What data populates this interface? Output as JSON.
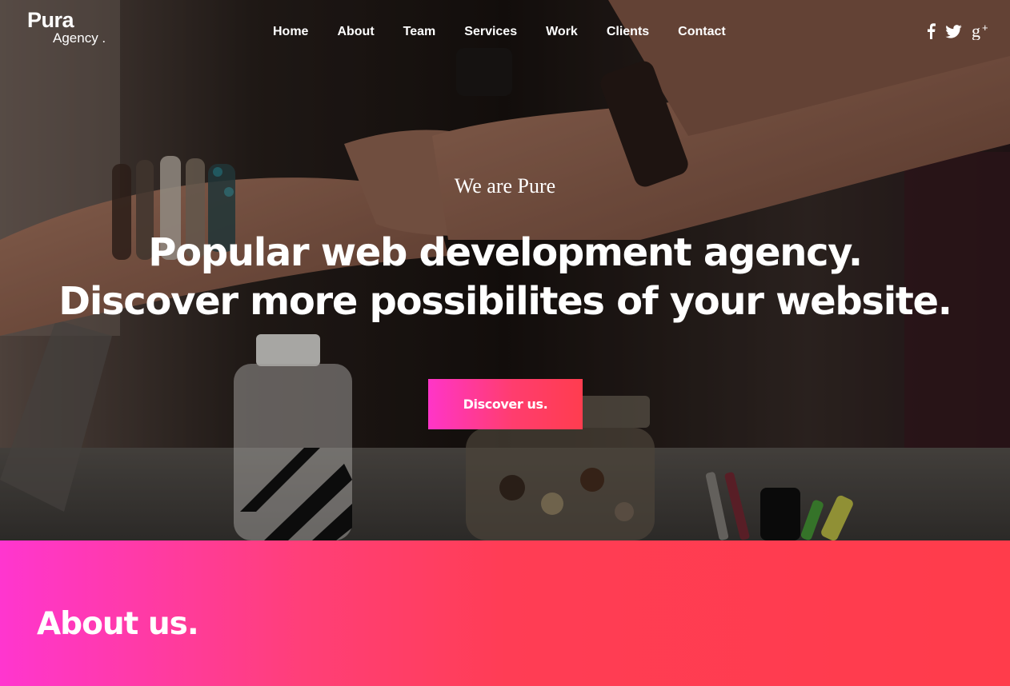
{
  "brand": {
    "name": "Pura",
    "subname": "Agency ."
  },
  "nav": {
    "items": [
      {
        "label": "Home"
      },
      {
        "label": "About"
      },
      {
        "label": "Team"
      },
      {
        "label": "Services"
      },
      {
        "label": "Work"
      },
      {
        "label": "Clients"
      },
      {
        "label": "Contact"
      }
    ]
  },
  "socials": [
    {
      "icon": "facebook-icon"
    },
    {
      "icon": "twitter-icon"
    },
    {
      "icon": "google-plus-icon"
    }
  ],
  "hero": {
    "tagline": "We are Pure",
    "headline_line1": "Popular web development agency.",
    "headline_line2": "Discover more possibilites of your website.",
    "cta_label": "Discover us."
  },
  "about": {
    "title": "About us."
  },
  "colors": {
    "accent_pink": "#ff35c8",
    "accent_red": "#ff3d4f",
    "text": "#ffffff"
  }
}
